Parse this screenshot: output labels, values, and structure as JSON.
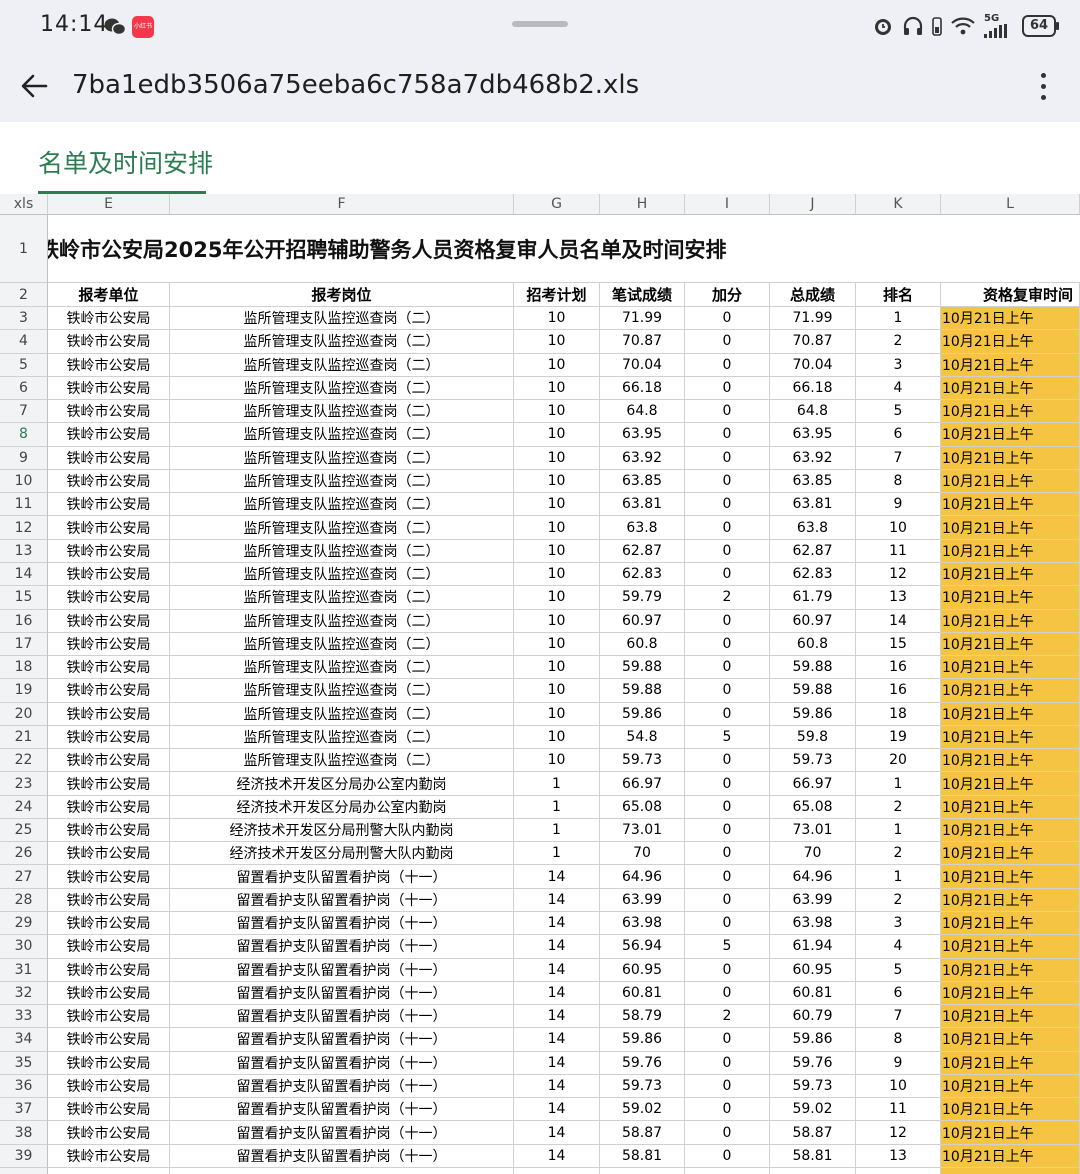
{
  "status_bar": {
    "time": "14:14",
    "network": "5G",
    "battery": "64",
    "mini_app_label": "小红书"
  },
  "app_bar": {
    "file_name": "7ba1edb3506a75eeba6c758a7db468b2.xls"
  },
  "sheet_tabs": [
    {
      "label": "名单及时间安排",
      "active": true
    }
  ],
  "grid": {
    "corner_label": "xls",
    "column_letters": [
      "E",
      "F",
      "G",
      "H",
      "I",
      "J",
      "K",
      "L"
    ],
    "title_row_number": "1",
    "title": "铁岭市公安局2025年公开招聘辅助警务人员资格复审人员名单及时间安排",
    "header_row_number": "2",
    "headers": [
      "报考单位",
      "报考岗位",
      "招考计划",
      "笔试成绩",
      "加分",
      "总成绩",
      "排名",
      "资格复审时间"
    ],
    "selected_row": "8",
    "highlight_color": "#f6c443",
    "rows": [
      [
        "3",
        "铁岭市公安局",
        "监所管理支队监控巡查岗（二）",
        "10",
        "71.99",
        "0",
        "71.99",
        "1",
        "10月21日上午"
      ],
      [
        "4",
        "铁岭市公安局",
        "监所管理支队监控巡查岗（二）",
        "10",
        "70.87",
        "0",
        "70.87",
        "2",
        "10月21日上午"
      ],
      [
        "5",
        "铁岭市公安局",
        "监所管理支队监控巡查岗（二）",
        "10",
        "70.04",
        "0",
        "70.04",
        "3",
        "10月21日上午"
      ],
      [
        "6",
        "铁岭市公安局",
        "监所管理支队监控巡查岗（二）",
        "10",
        "66.18",
        "0",
        "66.18",
        "4",
        "10月21日上午"
      ],
      [
        "7",
        "铁岭市公安局",
        "监所管理支队监控巡查岗（二）",
        "10",
        "64.8",
        "0",
        "64.8",
        "5",
        "10月21日上午"
      ],
      [
        "8",
        "铁岭市公安局",
        "监所管理支队监控巡查岗（二）",
        "10",
        "63.95",
        "0",
        "63.95",
        "6",
        "10月21日上午"
      ],
      [
        "9",
        "铁岭市公安局",
        "监所管理支队监控巡查岗（二）",
        "10",
        "63.92",
        "0",
        "63.92",
        "7",
        "10月21日上午"
      ],
      [
        "10",
        "铁岭市公安局",
        "监所管理支队监控巡查岗（二）",
        "10",
        "63.85",
        "0",
        "63.85",
        "8",
        "10月21日上午"
      ],
      [
        "11",
        "铁岭市公安局",
        "监所管理支队监控巡查岗（二）",
        "10",
        "63.81",
        "0",
        "63.81",
        "9",
        "10月21日上午"
      ],
      [
        "12",
        "铁岭市公安局",
        "监所管理支队监控巡查岗（二）",
        "10",
        "63.8",
        "0",
        "63.8",
        "10",
        "10月21日上午"
      ],
      [
        "13",
        "铁岭市公安局",
        "监所管理支队监控巡查岗（二）",
        "10",
        "62.87",
        "0",
        "62.87",
        "11",
        "10月21日上午"
      ],
      [
        "14",
        "铁岭市公安局",
        "监所管理支队监控巡查岗（二）",
        "10",
        "62.83",
        "0",
        "62.83",
        "12",
        "10月21日上午"
      ],
      [
        "15",
        "铁岭市公安局",
        "监所管理支队监控巡查岗（二）",
        "10",
        "59.79",
        "2",
        "61.79",
        "13",
        "10月21日上午"
      ],
      [
        "16",
        "铁岭市公安局",
        "监所管理支队监控巡查岗（二）",
        "10",
        "60.97",
        "0",
        "60.97",
        "14",
        "10月21日上午"
      ],
      [
        "17",
        "铁岭市公安局",
        "监所管理支队监控巡查岗（二）",
        "10",
        "60.8",
        "0",
        "60.8",
        "15",
        "10月21日上午"
      ],
      [
        "18",
        "铁岭市公安局",
        "监所管理支队监控巡查岗（二）",
        "10",
        "59.88",
        "0",
        "59.88",
        "16",
        "10月21日上午"
      ],
      [
        "19",
        "铁岭市公安局",
        "监所管理支队监控巡查岗（二）",
        "10",
        "59.88",
        "0",
        "59.88",
        "16",
        "10月21日上午"
      ],
      [
        "20",
        "铁岭市公安局",
        "监所管理支队监控巡查岗（二）",
        "10",
        "59.86",
        "0",
        "59.86",
        "18",
        "10月21日上午"
      ],
      [
        "21",
        "铁岭市公安局",
        "监所管理支队监控巡查岗（二）",
        "10",
        "54.8",
        "5",
        "59.8",
        "19",
        "10月21日上午"
      ],
      [
        "22",
        "铁岭市公安局",
        "监所管理支队监控巡查岗（二）",
        "10",
        "59.73",
        "0",
        "59.73",
        "20",
        "10月21日上午"
      ],
      [
        "23",
        "铁岭市公安局",
        "经济技术开发区分局办公室内勤岗",
        "1",
        "66.97",
        "0",
        "66.97",
        "1",
        "10月21日上午"
      ],
      [
        "24",
        "铁岭市公安局",
        "经济技术开发区分局办公室内勤岗",
        "1",
        "65.08",
        "0",
        "65.08",
        "2",
        "10月21日上午"
      ],
      [
        "25",
        "铁岭市公安局",
        "经济技术开发区分局刑警大队内勤岗",
        "1",
        "73.01",
        "0",
        "73.01",
        "1",
        "10月21日上午"
      ],
      [
        "26",
        "铁岭市公安局",
        "经济技术开发区分局刑警大队内勤岗",
        "1",
        "70",
        "0",
        "70",
        "2",
        "10月21日上午"
      ],
      [
        "27",
        "铁岭市公安局",
        "留置看护支队留置看护岗（十一）",
        "14",
        "64.96",
        "0",
        "64.96",
        "1",
        "10月21日上午"
      ],
      [
        "28",
        "铁岭市公安局",
        "留置看护支队留置看护岗（十一）",
        "14",
        "63.99",
        "0",
        "63.99",
        "2",
        "10月21日上午"
      ],
      [
        "29",
        "铁岭市公安局",
        "留置看护支队留置看护岗（十一）",
        "14",
        "63.98",
        "0",
        "63.98",
        "3",
        "10月21日上午"
      ],
      [
        "30",
        "铁岭市公安局",
        "留置看护支队留置看护岗（十一）",
        "14",
        "56.94",
        "5",
        "61.94",
        "4",
        "10月21日上午"
      ],
      [
        "31",
        "铁岭市公安局",
        "留置看护支队留置看护岗（十一）",
        "14",
        "60.95",
        "0",
        "60.95",
        "5",
        "10月21日上午"
      ],
      [
        "32",
        "铁岭市公安局",
        "留置看护支队留置看护岗（十一）",
        "14",
        "60.81",
        "0",
        "60.81",
        "6",
        "10月21日上午"
      ],
      [
        "33",
        "铁岭市公安局",
        "留置看护支队留置看护岗（十一）",
        "14",
        "58.79",
        "2",
        "60.79",
        "7",
        "10月21日上午"
      ],
      [
        "34",
        "铁岭市公安局",
        "留置看护支队留置看护岗（十一）",
        "14",
        "59.86",
        "0",
        "59.86",
        "8",
        "10月21日上午"
      ],
      [
        "35",
        "铁岭市公安局",
        "留置看护支队留置看护岗（十一）",
        "14",
        "59.76",
        "0",
        "59.76",
        "9",
        "10月21日上午"
      ],
      [
        "36",
        "铁岭市公安局",
        "留置看护支队留置看护岗（十一）",
        "14",
        "59.73",
        "0",
        "59.73",
        "10",
        "10月21日上午"
      ],
      [
        "37",
        "铁岭市公安局",
        "留置看护支队留置看护岗（十一）",
        "14",
        "59.02",
        "0",
        "59.02",
        "11",
        "10月21日上午"
      ],
      [
        "38",
        "铁岭市公安局",
        "留置看护支队留置看护岗（十一）",
        "14",
        "58.87",
        "0",
        "58.87",
        "12",
        "10月21日上午"
      ],
      [
        "39",
        "铁岭市公安局",
        "留置看护支队留置看护岗（十一）",
        "14",
        "58.81",
        "0",
        "58.81",
        "13",
        "10月21日上午"
      ]
    ]
  }
}
